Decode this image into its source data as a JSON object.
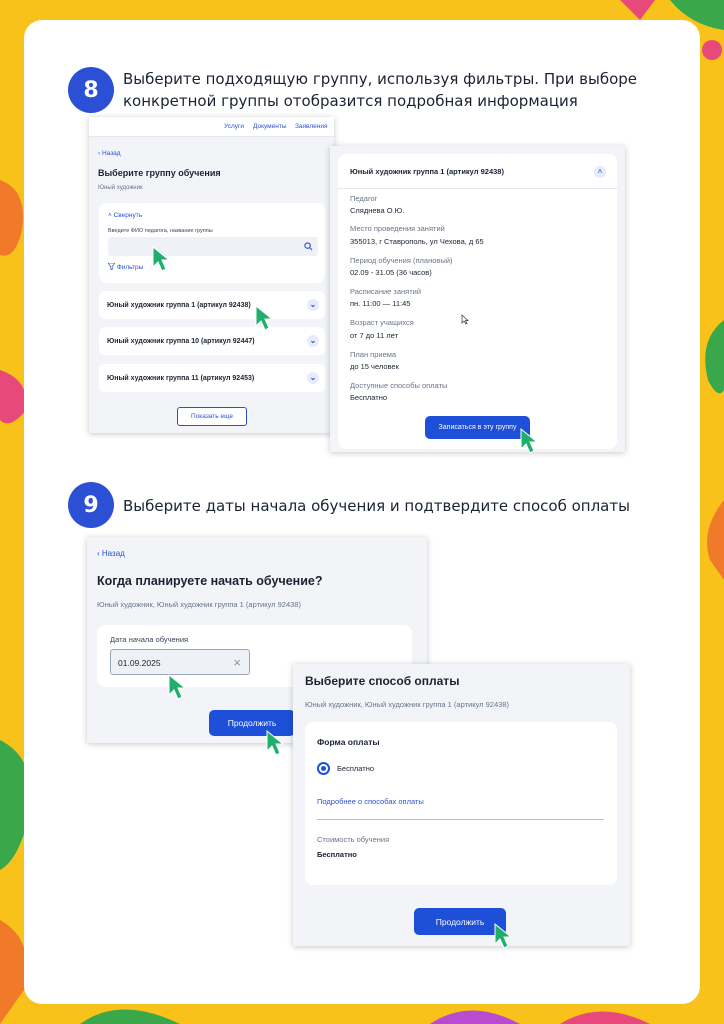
{
  "colors": {
    "background": "#f9c21a",
    "accent": "#2b50d6",
    "button": "#1d4fd8",
    "cursor": "#1fae6b"
  },
  "step8": {
    "number": "8",
    "text_line1": "Выберите подходящую группу, используя фильтры. При выборе",
    "text_line2": "конкретной группы отобразится подробная информация",
    "left_shot": {
      "nav": [
        "Услуги",
        "Документы",
        "Заявления"
      ],
      "back": "‹ Назад",
      "title": "Выберите группу обучения",
      "subtitle": "Юный художник",
      "collapse": "Свернуть",
      "search_label": "Введите ФИО педагога, название группы",
      "filters": "Фильтры",
      "groups": [
        "Юный художник группа 1 (артикул 92438)",
        "Юный художник группа 10 (артикул 92447)",
        "Юный художник группа 11 (артикул 92453)"
      ],
      "show_more": "Показать еще"
    },
    "right_shot": {
      "group_title": "Юный художник группа 1 (артикул 92438)",
      "details": [
        {
          "label": "Педагог",
          "value": "Сляднева О.Ю."
        },
        {
          "label": "Место проведения занятий",
          "value": "355013, г Ставрополь, ул Чехова, д 65"
        },
        {
          "label": "Период обучения (плановый)",
          "value": "02.09 - 31.05 (36 часов)"
        },
        {
          "label": "Расписание занятий",
          "value": "пн. 11:00 — 11:45"
        },
        {
          "label": "Возраст учащихся",
          "value": "от 7 до 11 лет"
        },
        {
          "label": "План приема",
          "value": "до 15 человек"
        },
        {
          "label": "Доступные способы оплаты",
          "value": "Бесплатно"
        }
      ],
      "enroll_button": "Записаться в эту группу"
    }
  },
  "step9": {
    "number": "9",
    "text": "Выберите даты начала обучения и подтвердите способ оплаты",
    "date_shot": {
      "back": "‹ Назад",
      "title": "Когда планируете начать обучение?",
      "subtitle": "Юный художник, Юный художник группа 1 (артикул 92438)",
      "date_label": "Дата начала обучения",
      "date_value": "01.09.2025",
      "continue": "Продолжить"
    },
    "payment_shot": {
      "title": "Выберите способ оплаты",
      "subtitle": "Юный художник, Юный художник группа 1 (артикул 92438)",
      "form_label": "Форма оплаты",
      "option": "Бесплатно",
      "more_link": "Подробнее о способах оплаты",
      "cost_label": "Стоимость обучения",
      "cost_value": "Бесплатно",
      "continue": "Продолжить"
    }
  }
}
